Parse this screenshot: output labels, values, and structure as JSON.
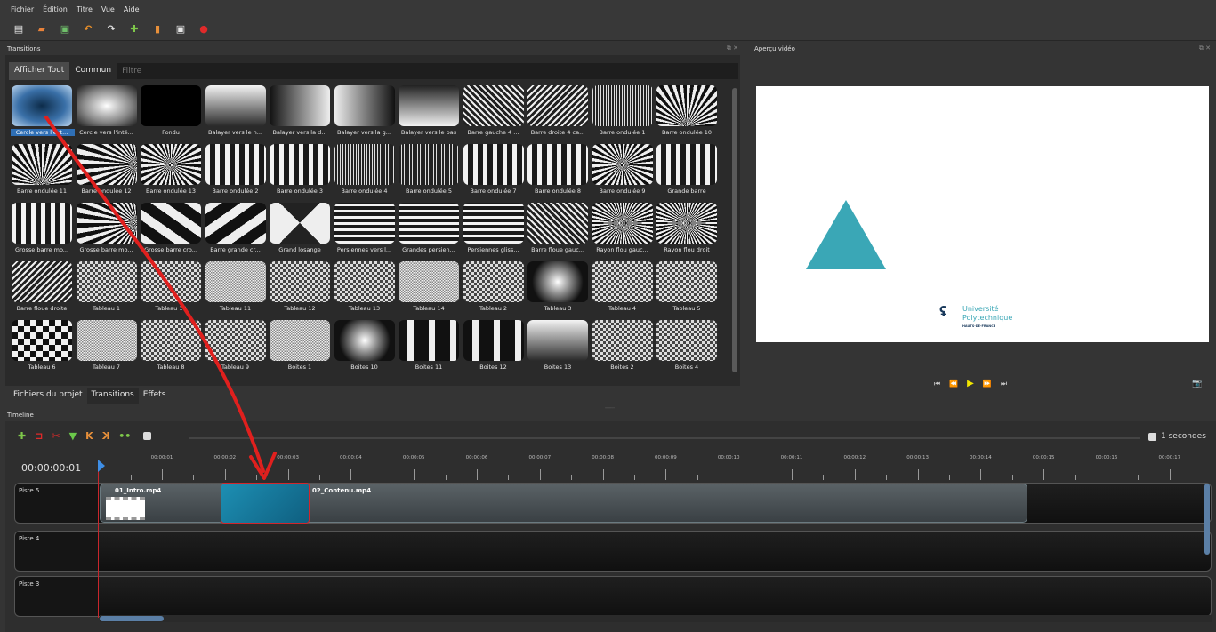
{
  "menu": [
    "Fichier",
    "Édition",
    "Titre",
    "Vue",
    "Aide"
  ],
  "toolbar_icons": [
    {
      "name": "new-project-icon",
      "glyph": "▤",
      "color": "#e8e8e8"
    },
    {
      "name": "open-project-icon",
      "glyph": "▰",
      "color": "#e8823a"
    },
    {
      "name": "save-project-icon",
      "glyph": "▣",
      "color": "#6fbf6a"
    },
    {
      "name": "undo-icon",
      "glyph": "↶",
      "color": "#e88f2a"
    },
    {
      "name": "redo-icon",
      "glyph": "↷",
      "color": "#dddddd"
    },
    {
      "name": "import-files-icon",
      "glyph": "✚",
      "color": "#7ec84a"
    },
    {
      "name": "choose-profile-icon",
      "glyph": "▮",
      "color": "#e8903a"
    },
    {
      "name": "fullscreen-icon",
      "glyph": "▣",
      "color": "#e8e8e8"
    },
    {
      "name": "export-video-icon",
      "glyph": "●",
      "color": "#e02a2a"
    }
  ],
  "panels": {
    "transitions": "Transitions",
    "preview": "Aperçu vidéo",
    "timeline": "Timeline",
    "panel_ctrls": "⧉ ✕"
  },
  "tabs": {
    "show_all": "Afficher Tout",
    "common": "Commun",
    "filter_placeholder": "Filtre"
  },
  "transitions": [
    {
      "label": "Cercle vers l'ext...",
      "pattern": "circle-out"
    },
    {
      "label": "Cercle vers l'inté...",
      "pattern": "circle-in"
    },
    {
      "label": "Fondu",
      "pattern": "black"
    },
    {
      "label": "Balayer vers le h...",
      "pattern": "grad-up"
    },
    {
      "label": "Balayer vers la d...",
      "pattern": "grad-right"
    },
    {
      "label": "Balayer vers la g...",
      "pattern": "grad-left"
    },
    {
      "label": "Balayer vers le bas",
      "pattern": "grad-down"
    },
    {
      "label": "Barre gauche 4 ...",
      "pattern": "diag"
    },
    {
      "label": "Barre droite 4 ca...",
      "pattern": "diag2"
    },
    {
      "label": "Barre ondulée 1",
      "pattern": "vstripes-fine"
    },
    {
      "label": "Barre ondulée 10",
      "pattern": "fan"
    },
    {
      "label": "Barre ondulée 11",
      "pattern": "fan"
    },
    {
      "label": "Barre ondulée 12",
      "pattern": "fan2"
    },
    {
      "label": "Barre ondulée 13",
      "pattern": "radial"
    },
    {
      "label": "Barre ondulée 2",
      "pattern": "vstripes"
    },
    {
      "label": "Barre ondulée 3",
      "pattern": "vstripes"
    },
    {
      "label": "Barre ondulée 4",
      "pattern": "vstripes-fine"
    },
    {
      "label": "Barre ondulée 5",
      "pattern": "vstripes-fine"
    },
    {
      "label": "Barre ondulée 7",
      "pattern": "vstripes"
    },
    {
      "label": "Barre ondulée 8",
      "pattern": "vstripes"
    },
    {
      "label": "Barre ondulée 9",
      "pattern": "radial"
    },
    {
      "label": "Grande barre",
      "pattern": "vstripes"
    },
    {
      "label": "Grosse barre mo...",
      "pattern": "vstripes"
    },
    {
      "label": "Grosse barre mo...",
      "pattern": "fan2"
    },
    {
      "label": "Grosse barre cro...",
      "pattern": "diag-big"
    },
    {
      "label": "Barre grande cr...",
      "pattern": "diag-big2"
    },
    {
      "label": "Grand losange",
      "pattern": "diamond"
    },
    {
      "label": "Persiennes vers l...",
      "pattern": "hstripes"
    },
    {
      "label": "Grandes persien...",
      "pattern": "hstripes"
    },
    {
      "label": "Persiennes gliss...",
      "pattern": "hstripes"
    },
    {
      "label": "Barre floue gauc...",
      "pattern": "diag"
    },
    {
      "label": "Rayon flou gauc...",
      "pattern": "hfan"
    },
    {
      "label": "Rayon flou droit",
      "pattern": "hfan"
    },
    {
      "label": "Barre floue droite",
      "pattern": "diag2"
    },
    {
      "label": "Tableau 1",
      "pattern": "checker"
    },
    {
      "label": "Tableau 10",
      "pattern": "checker"
    },
    {
      "label": "Tableau 11",
      "pattern": "checker-fine"
    },
    {
      "label": "Tableau 12",
      "pattern": "checker"
    },
    {
      "label": "Tableau 13",
      "pattern": "checker"
    },
    {
      "label": "Tableau 14",
      "pattern": "checker-fine"
    },
    {
      "label": "Tableau 2",
      "pattern": "checker"
    },
    {
      "label": "Tableau 3",
      "pattern": "cross"
    },
    {
      "label": "Tableau 4",
      "pattern": "checker"
    },
    {
      "label": "Tableau 5",
      "pattern": "checker"
    },
    {
      "label": "Tableau 6",
      "pattern": "checker-big"
    },
    {
      "label": "Tableau 7",
      "pattern": "checker-fine"
    },
    {
      "label": "Tableau 8",
      "pattern": "checker"
    },
    {
      "label": "Tableau 9",
      "pattern": "checker"
    },
    {
      "label": "Boites 1",
      "pattern": "checker-fine"
    },
    {
      "label": "Boites 10",
      "pattern": "cross"
    },
    {
      "label": "Boites 11",
      "pattern": "boxes"
    },
    {
      "label": "Boites 12",
      "pattern": "boxes"
    },
    {
      "label": "Boites 13",
      "pattern": "grad-up"
    },
    {
      "label": "Boites 2",
      "pattern": "checker"
    },
    {
      "label": "Boites 4",
      "pattern": "checker"
    }
  ],
  "bottom_tabs": [
    "Fichiers du projet",
    "Transitions",
    "Effets"
  ],
  "preview": {
    "logo_line1": "Université",
    "logo_line2": "Polytechnique",
    "logo_line3": "HAUTS-DE-FRANCE",
    "triangle_color": "#3aa7b6"
  },
  "playback": {
    "first": "⏮",
    "rewind": "⏪",
    "play": "▶",
    "forward": "⏩",
    "last": "⏭",
    "camera": "📷"
  },
  "timeline": {
    "toolbar": [
      {
        "name": "add-track-icon",
        "glyph": "✚",
        "color": "#7ec84a"
      },
      {
        "name": "snap-icon",
        "glyph": "⊐",
        "color": "#e02a2a"
      },
      {
        "name": "razor-icon",
        "glyph": "✂",
        "color": "#e02a2a"
      },
      {
        "name": "add-marker-icon",
        "glyph": "▼",
        "color": "#6bc84a"
      },
      {
        "name": "previous-marker-icon",
        "glyph": "K",
        "color": "#e8903a"
      },
      {
        "name": "next-marker-icon",
        "glyph": "K",
        "color": "#e8903a"
      },
      {
        "name": "center-playhead-icon",
        "glyph": "••",
        "color": "#7ec84a"
      }
    ],
    "zoom": "1 secondes",
    "timecode": "00:00:00:01",
    "ticks": [
      "00:00:01",
      "00:00:02",
      "00:00:03",
      "00:00:04",
      "00:00:05",
      "00:00:06",
      "00:00:07",
      "00:00:08",
      "00:00:09",
      "00:00:10",
      "00:00:11",
      "00:00:12",
      "00:00:13",
      "00:00:14",
      "00:00:15",
      "00:00:16",
      "00:00:17"
    ],
    "tracks": [
      "Piste 5",
      "Piste 4",
      "Piste 3"
    ],
    "clips": [
      {
        "name": "01_Intro.mp4"
      },
      {
        "name": "02_Contenu.mp4"
      }
    ]
  },
  "colors": {
    "selection": "#2f6fb5",
    "accent": "#3e8ee6",
    "playhead": "#c8262c",
    "annotation_arrow": "#e0201e"
  }
}
